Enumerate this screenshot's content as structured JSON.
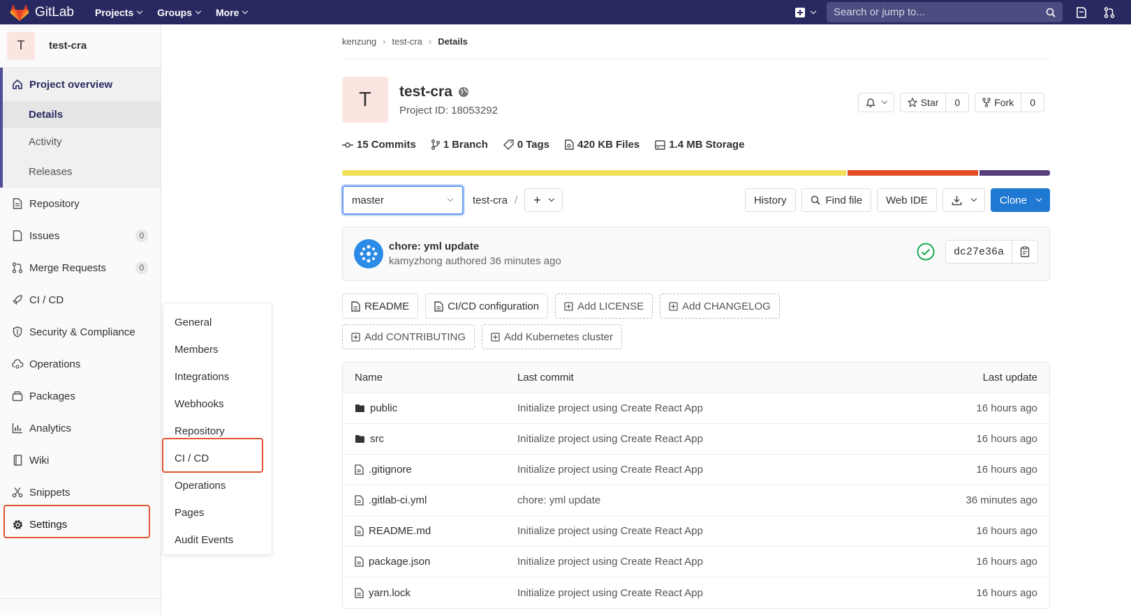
{
  "topbar": {
    "brand": "GitLab",
    "nav": [
      "Projects",
      "Groups",
      "More"
    ],
    "search_placeholder": "Search or jump to..."
  },
  "sidebar": {
    "avatar_letter": "T",
    "project_name": "test-cra",
    "overview": {
      "label": "Project overview",
      "subs": [
        "Details",
        "Activity",
        "Releases"
      ]
    },
    "items": [
      {
        "label": "Repository",
        "icon": "document-icon"
      },
      {
        "label": "Issues",
        "icon": "issues-icon",
        "badge": "0"
      },
      {
        "label": "Merge Requests",
        "icon": "merge-request-icon",
        "badge": "0"
      },
      {
        "label": "CI / CD",
        "icon": "rocket-icon"
      },
      {
        "label": "Security & Compliance",
        "icon": "shield-icon"
      },
      {
        "label": "Operations",
        "icon": "cloud-gear-icon"
      },
      {
        "label": "Packages",
        "icon": "package-icon"
      },
      {
        "label": "Analytics",
        "icon": "chart-icon"
      },
      {
        "label": "Wiki",
        "icon": "book-icon"
      },
      {
        "label": "Snippets",
        "icon": "scissors-icon"
      },
      {
        "label": "Settings",
        "icon": "gear-icon"
      }
    ]
  },
  "flyout": {
    "items": [
      "General",
      "Members",
      "Integrations",
      "Webhooks",
      "Repository",
      "CI / CD",
      "Operations",
      "Pages",
      "Audit Events"
    ]
  },
  "breadcrumb": [
    "kenzung",
    "test-cra",
    "Details"
  ],
  "project": {
    "avatar_letter": "T",
    "name": "test-cra",
    "id_text": "Project ID: 18053292",
    "star_label": "Star",
    "star_count": "0",
    "fork_label": "Fork",
    "fork_count": "0"
  },
  "stats": [
    {
      "num": "15",
      "label": "Commits",
      "icon": "commit-icon"
    },
    {
      "num": "1",
      "label": "Branch",
      "icon": "branch-icon"
    },
    {
      "num": "0",
      "label": "Tags",
      "icon": "tag-icon"
    },
    {
      "num": "420 KB",
      "label": "Files",
      "icon": "file-icon"
    },
    {
      "num": "1.4 MB",
      "label": "Storage",
      "icon": "storage-icon"
    }
  ],
  "languages": [
    {
      "share": 71.5,
      "color": "#f1e05a"
    },
    {
      "share": 18.5,
      "color": "#e34c26"
    },
    {
      "share": 10.0,
      "color": "#563d7c"
    }
  ],
  "toolbar": {
    "branch": "master",
    "path": "test-cra",
    "path_sep": "/",
    "history": "History",
    "find_file": "Find file",
    "web_ide": "Web IDE",
    "clone": "Clone"
  },
  "commit": {
    "title": "chore: yml update",
    "meta": "kamyzhong authored 36 minutes ago",
    "sha": "dc27e36a"
  },
  "quick_links": [
    {
      "label": "README",
      "dashed": false
    },
    {
      "label": "CI/CD configuration",
      "dashed": false
    },
    {
      "label": "Add LICENSE",
      "dashed": true
    },
    {
      "label": "Add CHANGELOG",
      "dashed": true
    },
    {
      "label": "Add CONTRIBUTING",
      "dashed": true
    },
    {
      "label": "Add Kubernetes cluster",
      "dashed": true
    }
  ],
  "files": {
    "headers": [
      "Name",
      "Last commit",
      "Last update"
    ],
    "rows": [
      {
        "name": "public",
        "type": "folder",
        "commit": "Initialize project using Create React App",
        "updated": "16 hours ago"
      },
      {
        "name": "src",
        "type": "folder",
        "commit": "Initialize project using Create React App",
        "updated": "16 hours ago"
      },
      {
        "name": ".gitignore",
        "type": "file",
        "commit": "Initialize project using Create React App",
        "updated": "16 hours ago"
      },
      {
        "name": ".gitlab-ci.yml",
        "type": "file",
        "commit": "chore: yml update",
        "updated": "36 minutes ago"
      },
      {
        "name": "README.md",
        "type": "file",
        "commit": "Initialize project using Create React App",
        "updated": "16 hours ago"
      },
      {
        "name": "package.json",
        "type": "file",
        "commit": "Initialize project using Create React App",
        "updated": "16 hours ago"
      },
      {
        "name": "yarn.lock",
        "type": "file",
        "commit": "Initialize project using Create React App",
        "updated": "16 hours ago"
      }
    ]
  }
}
